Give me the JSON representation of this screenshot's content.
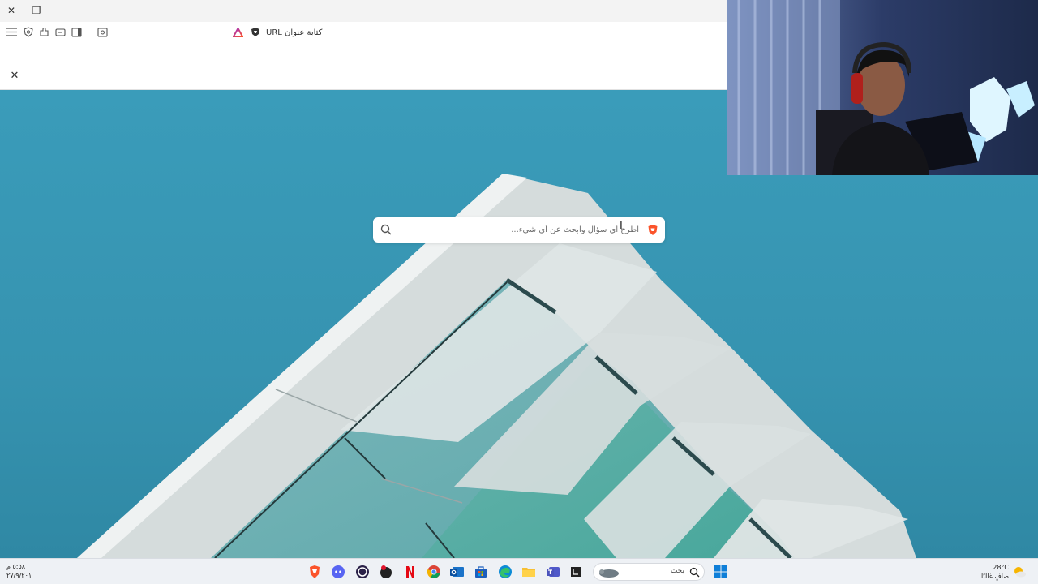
{
  "window": {
    "close_glyph": "✕",
    "restore_glyph": "❐",
    "minimize_glyph": "–"
  },
  "address_bar": {
    "placeholder": "كتابة عنوان URL"
  },
  "banner": {
    "close_glyph": "✕"
  },
  "search": {
    "placeholder": "اطرح أي سؤال وابحث عن أي شيء..."
  },
  "taskbar": {
    "clock_time": "٥:٥٨ م",
    "clock_date": "٢٧/٩/٢٠١",
    "weather_temp": "28°C",
    "weather_desc": "صافٍ غالبًا",
    "search_label": "بحث",
    "apps": [
      "brave-icon",
      "discord-icon",
      "obs-icon",
      "messenger-icon",
      "netflix-icon",
      "chrome-icon",
      "outlook-icon",
      "store-icon",
      "edge-icon",
      "file-explorer-icon",
      "teams-icon",
      "terminal-icon",
      "windows-start-icon"
    ]
  },
  "colors": {
    "sky": "#3a9cba",
    "brave_orange": "#fb542b",
    "taskbar_bg": "#eef1f5"
  }
}
